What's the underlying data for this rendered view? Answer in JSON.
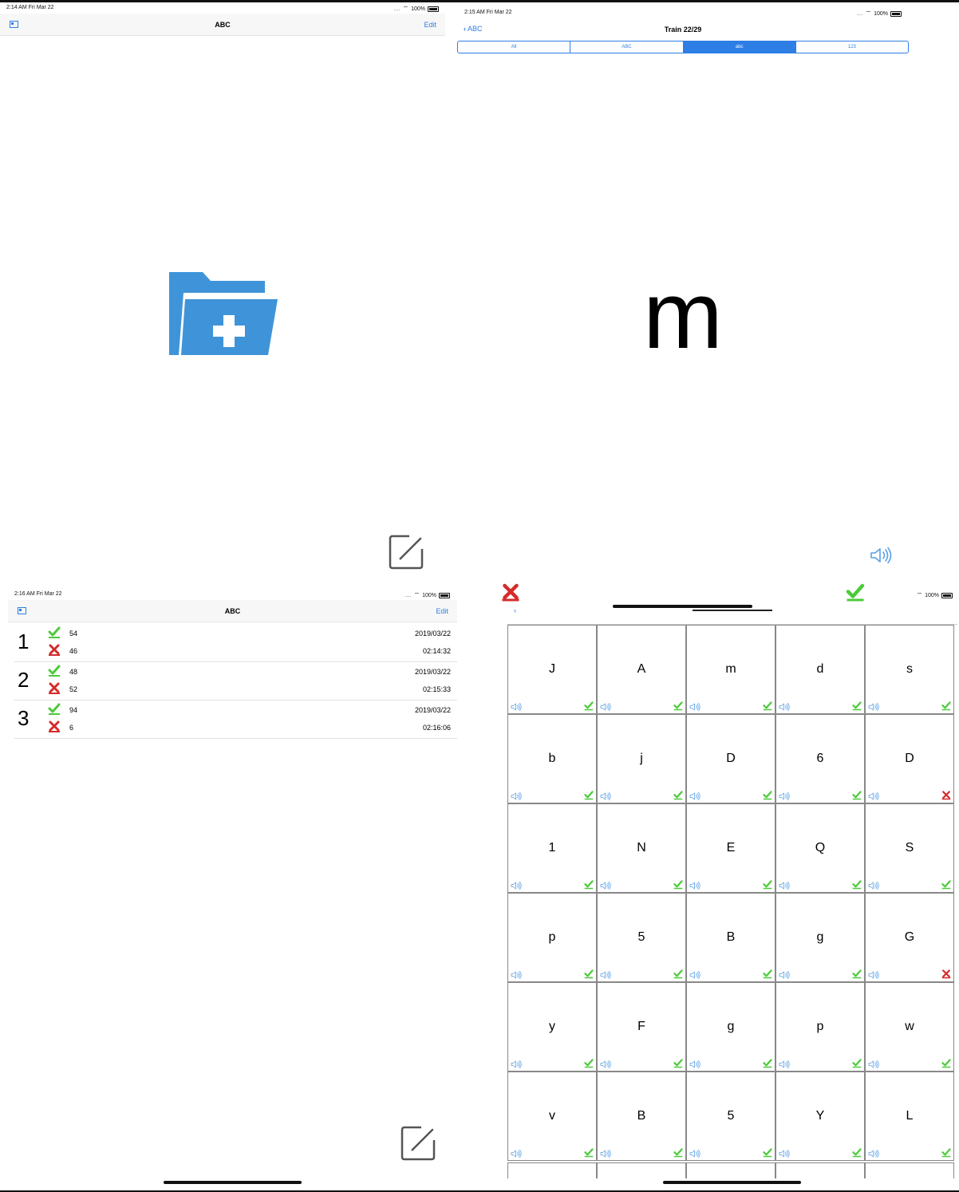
{
  "colors": {
    "accent": "#2d7ee5",
    "folder": "#3f94d9",
    "success": "#4ccb3a",
    "error": "#d52b2b"
  },
  "panel1": {
    "status": {
      "time": "2:14 AM  Fri Mar 22",
      "battery": "100%"
    },
    "nav": {
      "title": "ABC",
      "edit": "Edit"
    },
    "center_icon": "folder-add-icon",
    "action_icon": "compose-icon"
  },
  "panel2": {
    "status": {
      "time": "2:15 AM  Fri Mar 22",
      "battery": "100%"
    },
    "nav": {
      "back": "ABC",
      "title": "Train 22/29"
    },
    "segments": [
      "All",
      "ABC",
      "abc",
      "123"
    ],
    "selected_segment": "abc",
    "letter": "m",
    "speaker_icon": "speaker-icon"
  },
  "panel3": {
    "status": {
      "time": "2:16 AM  Fri Mar 22",
      "battery": "100%"
    },
    "nav": {
      "title": "ABC",
      "edit": "Edit"
    },
    "rows": [
      {
        "num": "1",
        "correct": "54",
        "wrong": "46",
        "date": "2019/03/22",
        "time": "02:14:32"
      },
      {
        "num": "2",
        "correct": "48",
        "wrong": "52",
        "date": "2019/03/22",
        "time": "02:15:33"
      },
      {
        "num": "3",
        "correct": "94",
        "wrong": "6",
        "date": "2019/03/22",
        "time": "02:16:06"
      }
    ]
  },
  "panel4": {
    "status": {
      "battery": "100%"
    },
    "grid": [
      {
        "l": "J",
        "ok": true
      },
      {
        "l": "A",
        "ok": true
      },
      {
        "l": "m",
        "ok": true
      },
      {
        "l": "d",
        "ok": true
      },
      {
        "l": "s",
        "ok": true
      },
      {
        "l": "b",
        "ok": true
      },
      {
        "l": "j",
        "ok": true
      },
      {
        "l": "D",
        "ok": true
      },
      {
        "l": "6",
        "ok": true
      },
      {
        "l": "D",
        "ok": false
      },
      {
        "l": "1",
        "ok": true
      },
      {
        "l": "N",
        "ok": true
      },
      {
        "l": "E",
        "ok": true
      },
      {
        "l": "Q",
        "ok": true
      },
      {
        "l": "S",
        "ok": true
      },
      {
        "l": "p",
        "ok": true
      },
      {
        "l": "5",
        "ok": true
      },
      {
        "l": "B",
        "ok": true
      },
      {
        "l": "g",
        "ok": true
      },
      {
        "l": "G",
        "ok": false
      },
      {
        "l": "y",
        "ok": true
      },
      {
        "l": "F",
        "ok": true
      },
      {
        "l": "g",
        "ok": true
      },
      {
        "l": "p",
        "ok": true
      },
      {
        "l": "w",
        "ok": true
      },
      {
        "l": "v",
        "ok": true
      },
      {
        "l": "B",
        "ok": true
      },
      {
        "l": "5",
        "ok": true
      },
      {
        "l": "Y",
        "ok": true
      },
      {
        "l": "L",
        "ok": true
      }
    ]
  }
}
